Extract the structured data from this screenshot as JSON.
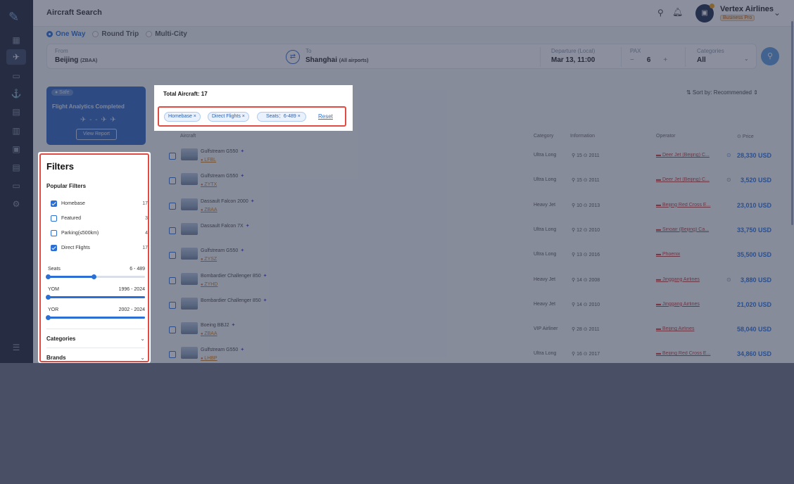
{
  "header": {
    "title": "Aircraft Search",
    "company": "Vertex Airlines",
    "plan": "Business Pro"
  },
  "trip_type": {
    "options": [
      "One Way",
      "Round Trip",
      "Multi-City"
    ],
    "selected": "One Way"
  },
  "search": {
    "from_label": "From",
    "from_value": "Beijing",
    "from_code": "(ZBAA)",
    "to_label": "To",
    "to_value": "Shanghai",
    "to_code": "(All airports)",
    "departure_label": "Departure (Local)",
    "departure_value": "Mar 13, 11:00",
    "pax_label": "PAX",
    "pax_value": "6",
    "pax_minus": "−",
    "pax_plus": "+",
    "categories_label": "Categories",
    "categories_value": "All"
  },
  "promo": {
    "badge": "● Safe",
    "title": "Flight Analytics Completed",
    "planes": "✈ - - ✈ ✈",
    "button": "View Report"
  },
  "filters": {
    "title": "Filters",
    "popular_title": "Popular Filters",
    "options": [
      {
        "label": "Homebase",
        "count": "17",
        "checked": true
      },
      {
        "label": "Featured",
        "count": "3",
        "checked": false
      },
      {
        "label": "Parking(≤500km)",
        "count": "4",
        "checked": false
      },
      {
        "label": "Direct Flights",
        "count": "17",
        "checked": true
      }
    ],
    "ranges": [
      {
        "label": "Seats",
        "value": "6 - 489",
        "low": 0.0,
        "high": 0.47
      },
      {
        "label": "YOM",
        "value": "1996 - 2024",
        "low": 0.0,
        "high": 1.0
      },
      {
        "label": "YOR",
        "value": "2002 - 2024",
        "low": 0.0,
        "high": 1.0
      }
    ],
    "sections": [
      "Categories",
      "Brands"
    ]
  },
  "results": {
    "total_label": "Total Aircraft: 17",
    "chips": [
      "Homebase ×",
      "Direct Flights ×",
      "Seats：6-489 ×"
    ],
    "reset": "Reset",
    "sort": "⇅  Sort by: Recommended  ⇕"
  },
  "table": {
    "headers": {
      "aircraft": "Aircraft",
      "category": "Category",
      "information": "Information",
      "operator": "Operator",
      "price": "Price"
    },
    "rows": [
      {
        "name": "Gulfstream G550",
        "code": "LFBL",
        "category": "Ultra Long",
        "info": "⚲ 15  ⊙ 2011",
        "operator": "Deer Jet (Beijing) C...",
        "price": "28,330 USD",
        "clock": true
      },
      {
        "name": "Gulfstream G550",
        "code": "ZYTX",
        "category": "Ultra Long",
        "info": "⚲ 15  ⊙ 2011",
        "operator": "Deer Jet (Beijing) C...",
        "price": "3,520 USD",
        "clock": true
      },
      {
        "name": "Dassault Falcon 2000",
        "code": "ZBAA",
        "category": "Heavy Jet",
        "info": "⚲ 10  ⊙ 2013",
        "operator": "Beijing Red Cross E...",
        "price": "23,010 USD",
        "clock": false
      },
      {
        "name": "Dassault Falcon 7X",
        "code": "",
        "category": "Ultra Long",
        "info": "⚲ 12  ⊙ 2010",
        "operator": "Sinoair (Beijing) Ca...",
        "price": "33,750 USD",
        "clock": false
      },
      {
        "name": "Gulfstream G550",
        "code": "ZYSZ",
        "category": "Ultra Long",
        "info": "⚲ 13  ⊙ 2016",
        "operator": "Phoenix",
        "price": "35,500 USD",
        "clock": false
      },
      {
        "name": "Bombardier Challenger 850",
        "code": "ZYHD",
        "category": "Heavy Jet",
        "info": "⚲ 14  ⊙ 2008",
        "operator": "Jinggang Airlines",
        "price": "3,880 USD",
        "clock": true
      },
      {
        "name": "Bombardier Challenger 850",
        "code": "",
        "category": "Heavy Jet",
        "info": "⚲ 14  ⊙ 2010",
        "operator": "Jinggang Airlines",
        "price": "21,020 USD",
        "clock": false
      },
      {
        "name": "Boeing BBJ2",
        "code": "ZBAA",
        "category": "VIP Airliner",
        "info": "⚲ 28  ⊙ 2011",
        "operator": "Beijing Airlines",
        "price": "58,040 USD",
        "clock": false
      },
      {
        "name": "Gulfstream G550",
        "code": "LHBP",
        "category": "Ultra Long",
        "info": "⚲ 16  ⊙ 2017",
        "operator": "Beijing Red Cross E...",
        "price": "34,860 USD",
        "clock": false
      }
    ]
  },
  "colors": {
    "accent": "#2c6fd4",
    "highlight_border": "#e04b43",
    "sidebar": "#1d2436"
  }
}
